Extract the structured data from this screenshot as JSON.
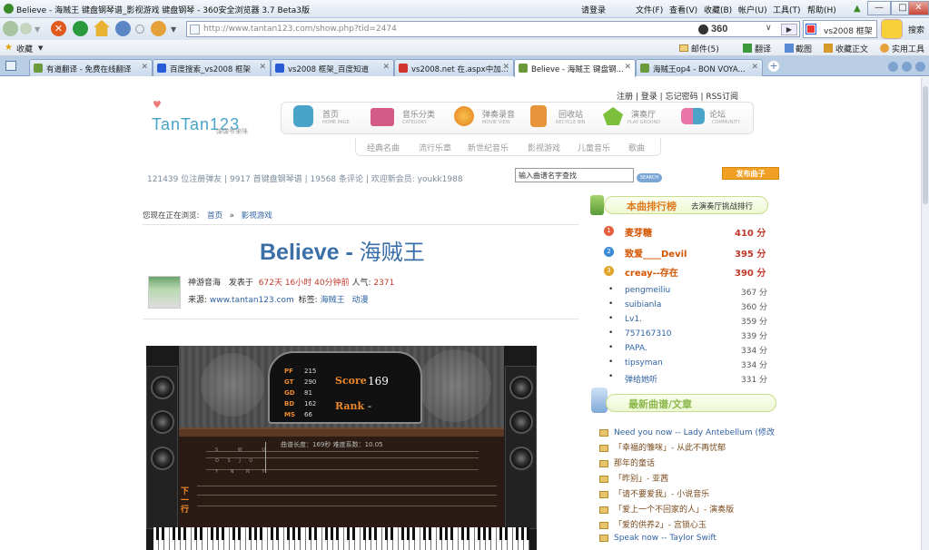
{
  "window": {
    "title": "Believe - 海贼王 键盘钢琴谱_影视游戏 键盘钢琴 - 360安全浏览器 3.7 Beta3版",
    "menu": [
      "请登录",
      "文件(F)",
      "查看(V)",
      "收藏(B)",
      "帐户(U)",
      "工具(T)",
      "帮助(H)"
    ]
  },
  "nav": {
    "url": "http://www.tantan123.com/show.php?tid=2474",
    "brand": "360",
    "search_hint": "vs2008 框架",
    "search_button": "搜索"
  },
  "favbar": {
    "fav_label": "收藏",
    "mail": "邮件(5)",
    "translate": "翻译",
    "screenshot": "截图",
    "collect": "收藏正文",
    "tools": "实用工具"
  },
  "tabs": [
    {
      "label": "有道翻译 - 免费在线翻译",
      "color": "#6a9a3c"
    },
    {
      "label": "百度搜索_vs2008 框架",
      "color": "#2a5bd7"
    },
    {
      "label": "vs2008 框架_百度知道",
      "color": "#2a5bd7"
    },
    {
      "label": "vs2008.net 在.aspx中加...",
      "color": "#d0342c"
    },
    {
      "label": "Believe - 海贼王 键盘钢...",
      "color": "#6a9a3c"
    },
    {
      "label": "海贼王op4 - BON VOYA...",
      "color": "#6a9a3c"
    }
  ],
  "site": {
    "logo": "TanTan123",
    "logo_sub": "弹弹爷来咪",
    "top_links": [
      "注册",
      "登录",
      "忘记密码",
      "RSS订阅"
    ],
    "nav": [
      {
        "label": "首页",
        "sub": "HOME PAGE"
      },
      {
        "label": "音乐分类",
        "sub": "CATEGORY"
      },
      {
        "label": "弹奏录音",
        "sub": "MOVIE VIEW"
      },
      {
        "label": "回收站",
        "sub": "RECYCLE BIN"
      },
      {
        "label": "演奏厅",
        "sub": "PLAY GROUND"
      },
      {
        "label": "论坛",
        "sub": "COMMUNITY"
      }
    ],
    "subnav": [
      "经典名曲",
      "流行乐章",
      "新世纪音乐",
      "影视游戏",
      "儿童音乐",
      "歌曲"
    ],
    "stats": [
      "121439 位注册弹友",
      "9917 首键盘钢琴谱",
      "19568 条评论",
      "欢迎新会员: youkk1988"
    ],
    "search_placeholder": "输入曲谱名字查找",
    "search_button": "SEARCH",
    "publish_button": "发布曲子"
  },
  "breadcrumb": {
    "prefix": "您现在正在浏览:",
    "home": "首页",
    "sep": "»",
    "section": "影视游戏"
  },
  "song": {
    "title_en": "Believe - ",
    "title_cn": "海贼王",
    "meta_author": "神游音海",
    "meta_posted": "发表于",
    "meta_time": "672天 16小时 40分钟前",
    "meta_pop_label": "人气:",
    "meta_pop": "2371",
    "source_label": "来源:",
    "source": "www.tantan123.com",
    "tags_label": "标签:",
    "tags": [
      "海贼王",
      "动漫"
    ]
  },
  "player": {
    "stats": [
      [
        "PF",
        "215"
      ],
      [
        "GT",
        "290"
      ],
      [
        "GD",
        "81"
      ],
      [
        "BD",
        "162"
      ],
      [
        "MS",
        "66"
      ]
    ],
    "score_label": "Score",
    "score": "169",
    "rank_label": "Rank",
    "rank": "-",
    "info": "曲谱长度：169秒 难度系数：10.05",
    "row1": [
      "S",
      "W",
      "U"
    ],
    "row2": [
      "O",
      "S",
      "J",
      "U"
    ],
    "row3": [
      "Y",
      "N",
      "N",
      "Y"
    ],
    "next": "下一行"
  },
  "ranking": {
    "title": "本曲排行榜",
    "link": "去演奏厅挑战排行",
    "top": [
      {
        "name": "麦芽糖",
        "score": "410 分"
      },
      {
        "name": "致爱____Devil",
        "score": "395 分"
      },
      {
        "name": "creay--存在",
        "score": "390 分"
      }
    ],
    "rest": [
      {
        "name": "pengmeiliu",
        "score": "367 分"
      },
      {
        "name": "suibianla",
        "score": "360 分"
      },
      {
        "name": "Lv1.",
        "score": "359 分"
      },
      {
        "name": "757167310",
        "score": "339 分"
      },
      {
        "name": "PAPA.",
        "score": "334 分"
      },
      {
        "name": "tipsyman",
        "score": "334 分"
      },
      {
        "name": "弹给她听",
        "score": "331 分"
      }
    ]
  },
  "news": {
    "title": "最新曲谱/文章",
    "items": [
      "Need you now -- Lady Antebellum (修改",
      "「幸福的雏咪」- 从此不再忧郁",
      "那年的童话",
      "「昨别」- 亚茜",
      "「请不要爱我」- 小说音乐",
      "「爱上一个不回家的人」- 演奏版",
      "「爱的供养2」- 宫锁心玉",
      "Speak now -- Taylor Swift"
    ]
  }
}
